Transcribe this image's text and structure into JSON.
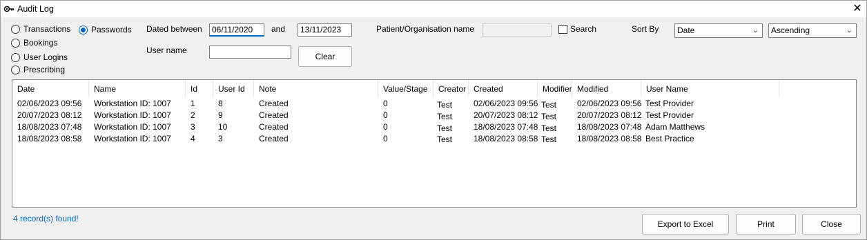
{
  "window": {
    "title": "Audit Log",
    "close_glyph": "✕",
    "icon": "key-icon"
  },
  "filters": {
    "types": [
      {
        "label": "Transactions",
        "selected": false
      },
      {
        "label": "Bookings",
        "selected": false
      },
      {
        "label": "User Logins",
        "selected": false
      },
      {
        "label": "Prescribing",
        "selected": false
      },
      {
        "label": "Passwords",
        "selected": true
      }
    ],
    "dated_between_label": "Dated between",
    "date_from": "06/11/2020",
    "and_label": "and",
    "date_to": "13/11/2023",
    "user_name_label": "User name",
    "user_name_value": "",
    "clear_label": "Clear",
    "patient_org_label": "Patient/Organisation name",
    "patient_org_value": "",
    "search_label": "Search",
    "sort_by_label": "Sort By",
    "sort_field": "Date",
    "sort_order": "Ascending"
  },
  "table": {
    "columns": [
      "Date",
      "Name",
      "Id",
      "User Id",
      "Note",
      "Value/Stage",
      "Creator",
      "Created",
      "Modifier",
      "Modified",
      "User Name"
    ],
    "rows": [
      [
        "02/06/2023 09:56",
        "Workstation ID: 1007",
        "1",
        "8",
        "Created",
        "0",
        "Test",
        "02/06/2023 09:56",
        "Test",
        "02/06/2023 09:56",
        "Test Provider"
      ],
      [
        "20/07/2023 08:12",
        "Workstation ID: 1007",
        "2",
        "9",
        "Created",
        "0",
        "Test",
        "20/07/2023 08:12",
        "Test",
        "20/07/2023 08:12",
        "Test Provider"
      ],
      [
        "18/08/2023 07:48",
        "Workstation ID: 1007",
        "3",
        "10",
        "Created",
        "0",
        "Test",
        "18/08/2023 07:48",
        "Test",
        "18/08/2023 07:48",
        "Adam Matthews"
      ],
      [
        "18/08/2023 08:58",
        "Workstation ID: 1007",
        "4",
        "3",
        "Created",
        "0",
        "Test",
        "18/08/2023 08:58",
        "Test",
        "18/08/2023 08:58",
        "Best Practice"
      ]
    ]
  },
  "footer": {
    "status": "4 record(s) found!",
    "export_label": "Export to Excel",
    "print_label": "Print",
    "close_label": "Close"
  }
}
